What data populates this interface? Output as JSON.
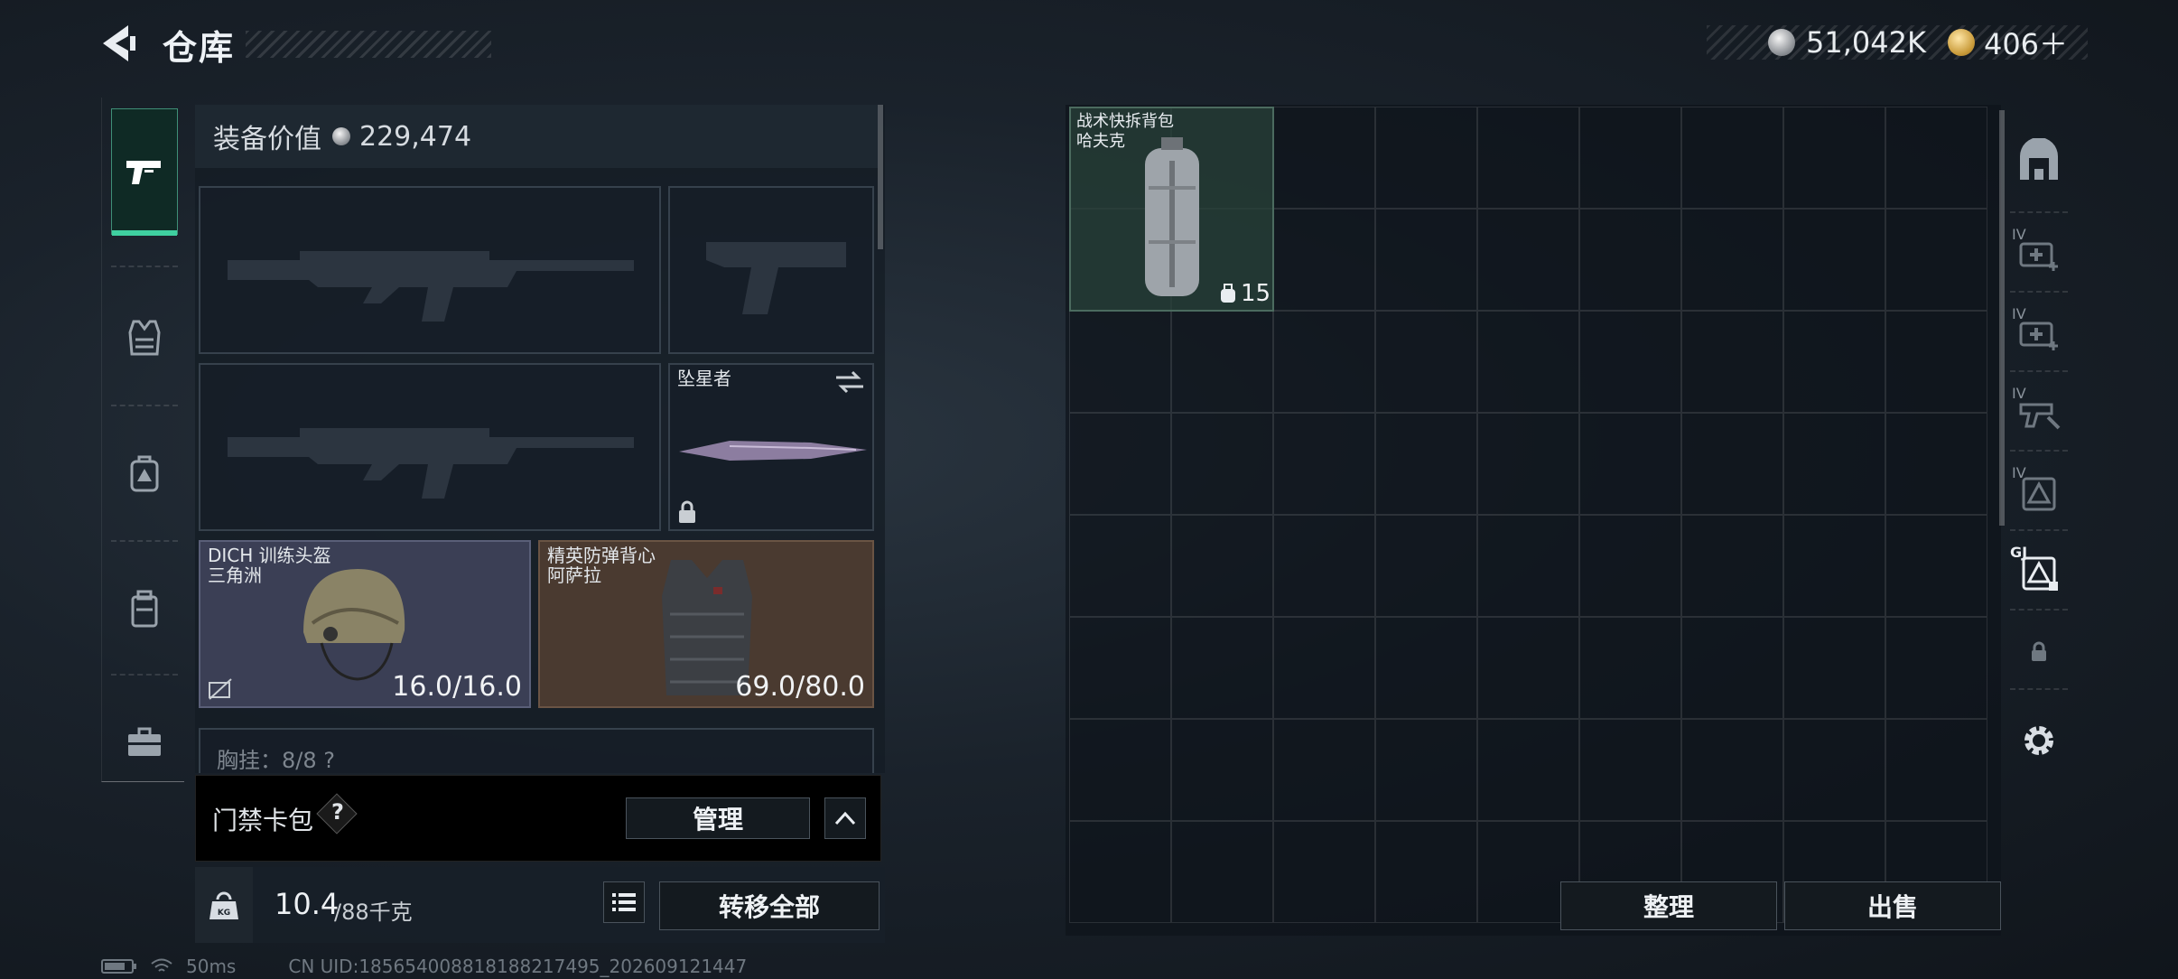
{
  "header": {
    "title": "仓库",
    "currency_silver": "51,042K",
    "currency_gold": "406＋"
  },
  "colors": {
    "accent": "#3fd0a0",
    "silver": "#9aa0a6",
    "gold": "#c99b3a",
    "helmet_bg": "#3b3f55",
    "armor_bg": "#4a3a30"
  },
  "left_rail": {
    "items": [
      {
        "icon": "pistol-icon",
        "active": true
      },
      {
        "icon": "vest-icon",
        "active": false
      },
      {
        "icon": "backpack-icon",
        "active": false
      },
      {
        "icon": "pouch-icon",
        "active": false
      },
      {
        "icon": "briefcase-icon",
        "active": false
      }
    ]
  },
  "equipment": {
    "value_label": "装备价值",
    "value": "229,474",
    "slots": {
      "primary_1": {
        "icon": "rifle-silhouette-icon"
      },
      "sidearm": {
        "icon": "pistol-silhouette-icon"
      },
      "primary_2": {
        "icon": "rifle-silhouette-icon"
      },
      "melee": {
        "name": "坠星者",
        "icon": "knife-icon",
        "locked": true
      },
      "helmet": {
        "name": "DICH 训练头盔",
        "subname": "三角洲",
        "durability": "16.0/16.0"
      },
      "armor": {
        "name": "精英防弹背心",
        "subname": "阿萨拉",
        "durability": "69.0/80.0"
      },
      "chest_rig": {
        "label": "胸挂：8/8 ?"
      }
    }
  },
  "card_bar": {
    "label": "门禁卡包",
    "help": "?",
    "manage_label": "管理"
  },
  "weight": {
    "current": "10.4",
    "max": "/88千克",
    "kg_badge": "KG",
    "transfer_all_label": "转移全部"
  },
  "backpack": {
    "item": {
      "name": "战术快拆背包",
      "subname": "哈夫克",
      "capacity": "15"
    },
    "sort_label": "整理",
    "sell_label": "出售"
  },
  "right_rail": {
    "items": [
      {
        "icon": "stash-icon",
        "tier": ""
      },
      {
        "icon": "medkit-icon",
        "tier": "IV"
      },
      {
        "icon": "medkit-icon",
        "tier": "IV"
      },
      {
        "icon": "gun-repair-icon",
        "tier": "IV"
      },
      {
        "icon": "armor-repair-icon",
        "tier": "IV"
      },
      {
        "icon": "armor-slot-icon",
        "tier": "GJ"
      },
      {
        "icon": "lock-icon",
        "tier": ""
      },
      {
        "icon": "gear-icon",
        "tier": ""
      }
    ]
  },
  "status": {
    "ping": "50ms",
    "uid": "CN UID:185654008818188217495_202609121447"
  }
}
